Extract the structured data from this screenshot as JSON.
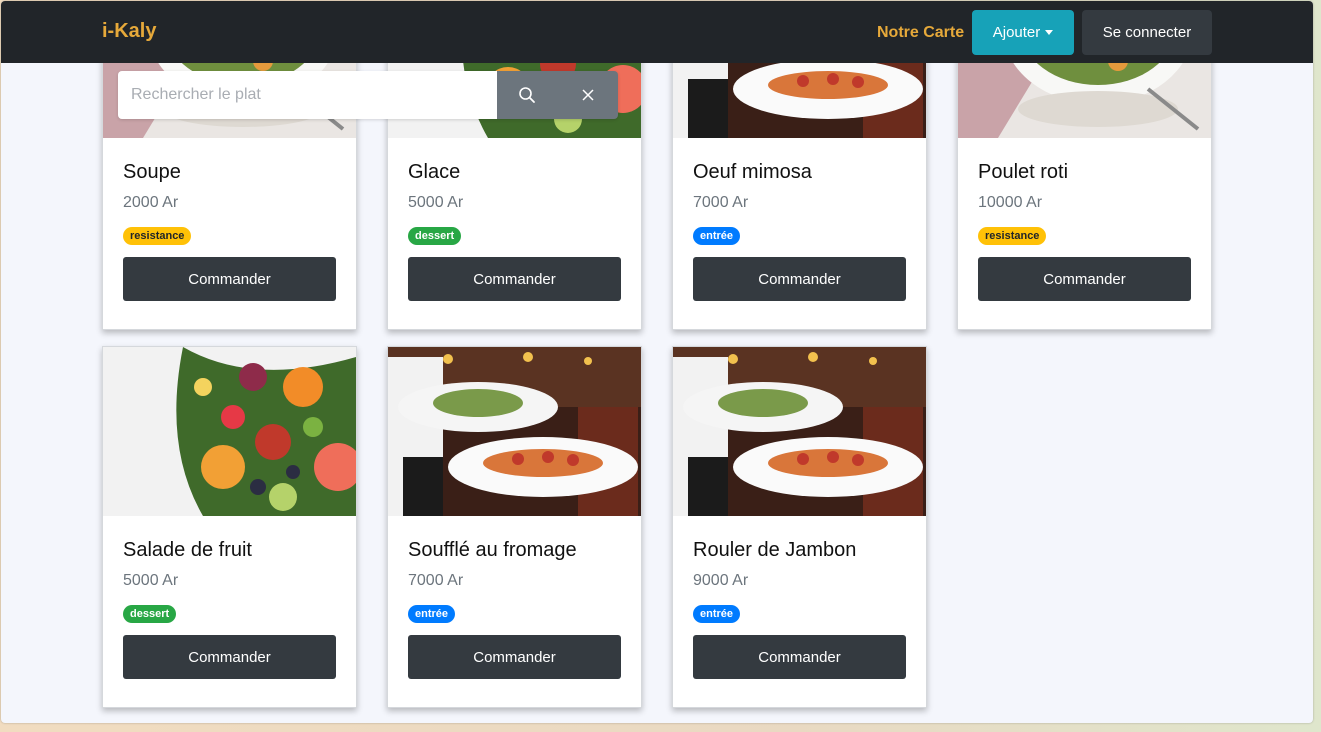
{
  "navbar": {
    "brand": "i-Kaly",
    "menu_link": "Notre Carte",
    "add_button": "Ajouter",
    "login_button": "Se connecter"
  },
  "search": {
    "placeholder": "Rechercher le plat",
    "value": ""
  },
  "cards": [
    {
      "name": "Soupe",
      "price": "2000 Ar",
      "category": "resistance",
      "image": "salad-bowl",
      "button": "Commander"
    },
    {
      "name": "Glace",
      "price": "5000 Ar",
      "category": "dessert",
      "image": "fruit-platter",
      "button": "Commander"
    },
    {
      "name": "Oeuf mimosa",
      "price": "7000 Ar",
      "category": "entrée",
      "image": "waiter-plates",
      "button": "Commander"
    },
    {
      "name": "Poulet roti",
      "price": "10000 Ar",
      "category": "resistance",
      "image": "salad-bowl",
      "button": "Commander"
    },
    {
      "name": "Salade de fruit",
      "price": "5000 Ar",
      "category": "dessert",
      "image": "fruit-platter",
      "button": "Commander"
    },
    {
      "name": "Soufflé au fromage",
      "price": "7000 Ar",
      "category": "entrée",
      "image": "waiter-plates",
      "button": "Commander"
    },
    {
      "name": "Rouler de Jambon",
      "price": "9000 Ar",
      "category": "entrée",
      "image": "waiter-plates",
      "button": "Commander"
    }
  ],
  "colors": {
    "navbar_bg": "#212529",
    "brand": "#e6a93a",
    "add_button": "#17a2b8",
    "login_button": "#343a40",
    "command_button": "#343a40",
    "badge_resistance": "#ffc107",
    "badge_dessert": "#28a745",
    "badge_entree": "#007bff",
    "search_button": "#6c757d"
  },
  "icons": {
    "search": "search-icon",
    "clear": "close-icon",
    "dropdown": "chevron-down-icon"
  }
}
